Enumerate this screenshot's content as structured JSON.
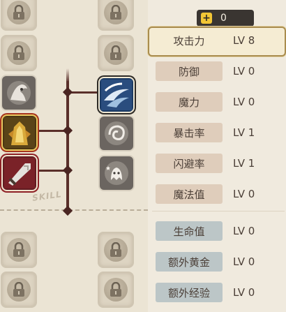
{
  "currency": {
    "icon": "plus-coin-icon",
    "value": "0"
  },
  "tree": {
    "label": "SKILL",
    "slots": [
      {
        "name": "locked-slot",
        "icon": "lock-icon"
      },
      {
        "name": "locked-slot",
        "icon": "lock-icon"
      },
      {
        "name": "locked-slot",
        "icon": "lock-icon"
      },
      {
        "name": "locked-slot",
        "icon": "lock-icon"
      },
      {
        "name": "skill-shadow-figure",
        "icon": "shadow-figure-icon"
      },
      {
        "name": "skill-wind-slash",
        "icon": "wind-slash-icon"
      },
      {
        "name": "skill-golden-armor",
        "icon": "golden-armor-icon"
      },
      {
        "name": "skill-whirlwind",
        "icon": "whirlwind-icon"
      },
      {
        "name": "skill-heavy-blade",
        "icon": "heavy-blade-icon"
      },
      {
        "name": "skill-sparkle-ghost",
        "icon": "sparkle-ghost-icon"
      },
      {
        "name": "locked-slot",
        "icon": "lock-icon"
      },
      {
        "name": "locked-slot",
        "icon": "lock-icon"
      },
      {
        "name": "locked-slot",
        "icon": "lock-icon"
      },
      {
        "name": "locked-slot",
        "icon": "lock-icon"
      }
    ]
  },
  "stats": [
    {
      "label": "攻击力",
      "level": "LV 8",
      "selected": true
    },
    {
      "label": "防御",
      "level": "LV 0"
    },
    {
      "label": "魔力",
      "level": "LV 0"
    },
    {
      "label": "暴击率",
      "level": "LV 1"
    },
    {
      "label": "闪避率",
      "level": "LV 1"
    },
    {
      "label": "魔法值",
      "level": "LV 0"
    },
    {
      "label": "生命值",
      "level": "LV 0"
    },
    {
      "label": "额外黄金",
      "level": "LV 0"
    },
    {
      "label": "额外经验",
      "level": "LV 0"
    }
  ],
  "colors": {
    "background": "#ece5d6",
    "branch": "#5a2f2a",
    "selected_border": "#a98c4e",
    "tan_label": "#dfcdbb",
    "blue_label": "#bcc6c7",
    "currency_bg": "#3a3531",
    "currency_icon": "#f2c636"
  }
}
